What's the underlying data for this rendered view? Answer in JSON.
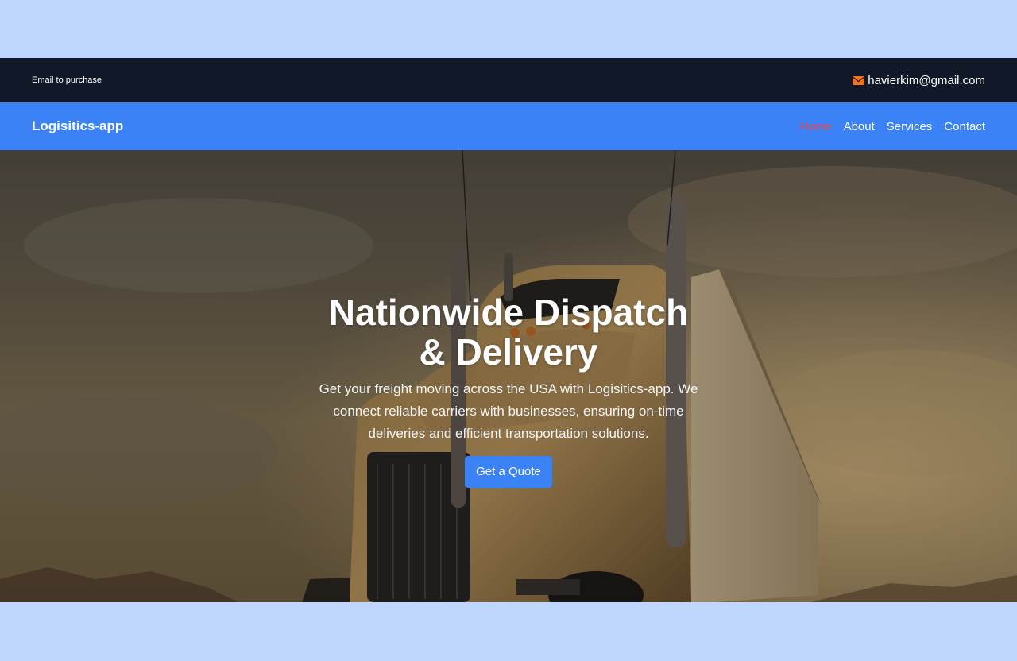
{
  "topbar": {
    "note": "Email to purchase",
    "email": "havierkim@gmail.com",
    "email_icon": "envelope-icon"
  },
  "navbar": {
    "brand": "Logisitics-app",
    "links": [
      {
        "label": "Home",
        "active": true
      },
      {
        "label": "About",
        "active": false
      },
      {
        "label": "Services",
        "active": false
      },
      {
        "label": "Contact",
        "active": false
      }
    ]
  },
  "hero": {
    "title": "Nationwide Dispatch & Delivery",
    "description": "Get your freight moving across the USA with Logisitics-app. We connect reliable carriers with businesses, ensuring on-time deliveries and efficient transportation solutions.",
    "cta_label": "Get a Quote",
    "image": "semi-truck-photo"
  },
  "colors": {
    "page_background": "#bfd7fe",
    "topbar_background": "#111827",
    "navbar_background": "#3b82f6",
    "active_link": "#ef4444",
    "button": "#3b82f6",
    "envelope_icon": "#f97316"
  }
}
